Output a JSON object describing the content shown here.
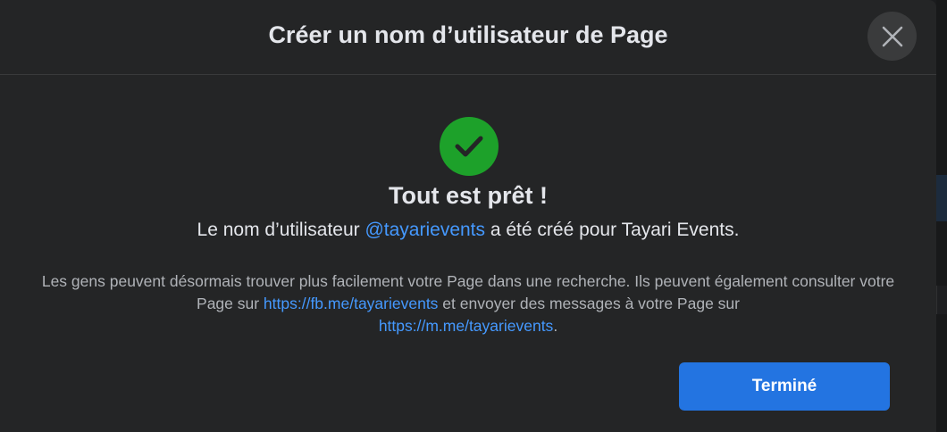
{
  "dialog": {
    "title": "Créer un nom d’utilisateur de Page",
    "close_icon": "close-icon",
    "success_icon": "checkmark-circle-icon",
    "heading": "Tout est prêt !",
    "subline": {
      "before": "Le nom d’utilisateur ",
      "username": "@tayarievents",
      "after": " a été créé pour Tayari Events."
    },
    "description": {
      "part1": "Les gens peuvent désormais trouver plus facilement votre Page dans une recherche. Ils peuvent également consulter votre Page sur ",
      "fb_link": "https://fb.me/tayarievents",
      "part2": " et envoyer des messages à votre Page sur ",
      "m_link": "https://m.me/tayarievents",
      "part3": "."
    },
    "done_label": "Terminé"
  },
  "colors": {
    "dialog_bg": "#242526",
    "text_primary": "#e4e6eb",
    "text_secondary": "#b0b3b8",
    "link": "#4599ff",
    "success": "#1da12a",
    "primary_button": "#2374e1"
  }
}
